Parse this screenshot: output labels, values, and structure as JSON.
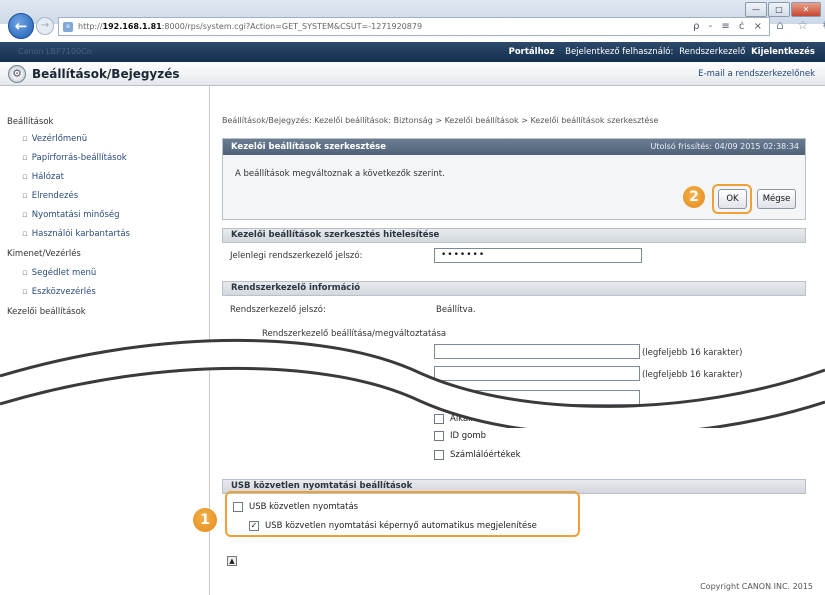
{
  "browser": {
    "url_prefix": "http://",
    "url_host": "192.168.1.81",
    "url_rest": ":8000/rps/system.cgi?Action=GET_SYSTEM&CSUT=-1271920879",
    "url_tools": "ρ - ≡ ċ ×",
    "favicon": "e",
    "right_icons": "⌂ ☆ ⚙"
  },
  "window_controls": {
    "minimize": "—",
    "maximize": "□",
    "close": "✕"
  },
  "topbar": {
    "device_faint": "Canon LBP7100Cn",
    "portal": "Portálhoz",
    "logged_in_label": "Bejelentkező felhasználó:",
    "logged_in_user": "Rendszerkezelő",
    "logout": "Kijelentkezés"
  },
  "header": {
    "title": "Beállítások/Bejegyzés",
    "mail_link": "E-mail a rendszerkezelőnek",
    "gear_glyph": "⚙"
  },
  "sidebar": {
    "cat1": "Beállítások",
    "items1": [
      "Vezérlőmenü",
      "Papírforrás-beállítások",
      "Hálózat",
      "Elrendezés",
      "Nyomtatási minőség",
      "Használói karbantartás"
    ],
    "cat2": "Kimenet/Vezérlés",
    "items2": [
      "Segédlet menü",
      "Eszközvezérlés"
    ],
    "cat3": "Kezelői beállítások"
  },
  "breadcrumb": "Beállítások/Bejegyzés: Kezelői beállítások: Biztonság > Kezelői beállítások > Kezelői beállítások szerkesztése",
  "edit_panel": {
    "title": "Kezelői beállítások szerkesztése",
    "last_updated": "Utolsó frissítés: 04/09 2015 02:38:34",
    "message": "A beállítások megváltoznak a következők szerint.",
    "ok": "OK",
    "cancel": "Mégse"
  },
  "auth_section": {
    "title": "Kezelői beállítások szerkesztés hitelesítése",
    "label": "Jelenlegi rendszerkezelő jelszó:",
    "value": "•••••••"
  },
  "admin_section": {
    "title": "Rendszerkezelő információ",
    "pw_label": "Rendszerkezelő jelszó:",
    "pw_value": "Beállítva.",
    "change_label": "Rendszerkezelő beállítása/megváltoztatása",
    "hint1": "(legfeljebb 16 karakter)",
    "hint2": "(legfeljebb 16 karakter)",
    "cb_app": "Alkalmazás gomb",
    "cb_id": "ID gomb",
    "cb_counter": "Számlálóértékek"
  },
  "usb_section": {
    "title": "USB közvetlen nyomtatási beállítások",
    "cb1_label": "USB közvetlen nyomtatás",
    "cb1_checked": false,
    "cb2_label": "USB közvetlen nyomtatási képernyő automatikus megjelenítése",
    "cb2_checked": true,
    "check_glyph": "✓"
  },
  "markers": {
    "one": "1",
    "two": "2"
  },
  "to_top_glyph": "▲",
  "footer": "Copyright CANON INC. 2015",
  "colors": {
    "highlight": "#f0a136",
    "header_band": "#15304e"
  }
}
